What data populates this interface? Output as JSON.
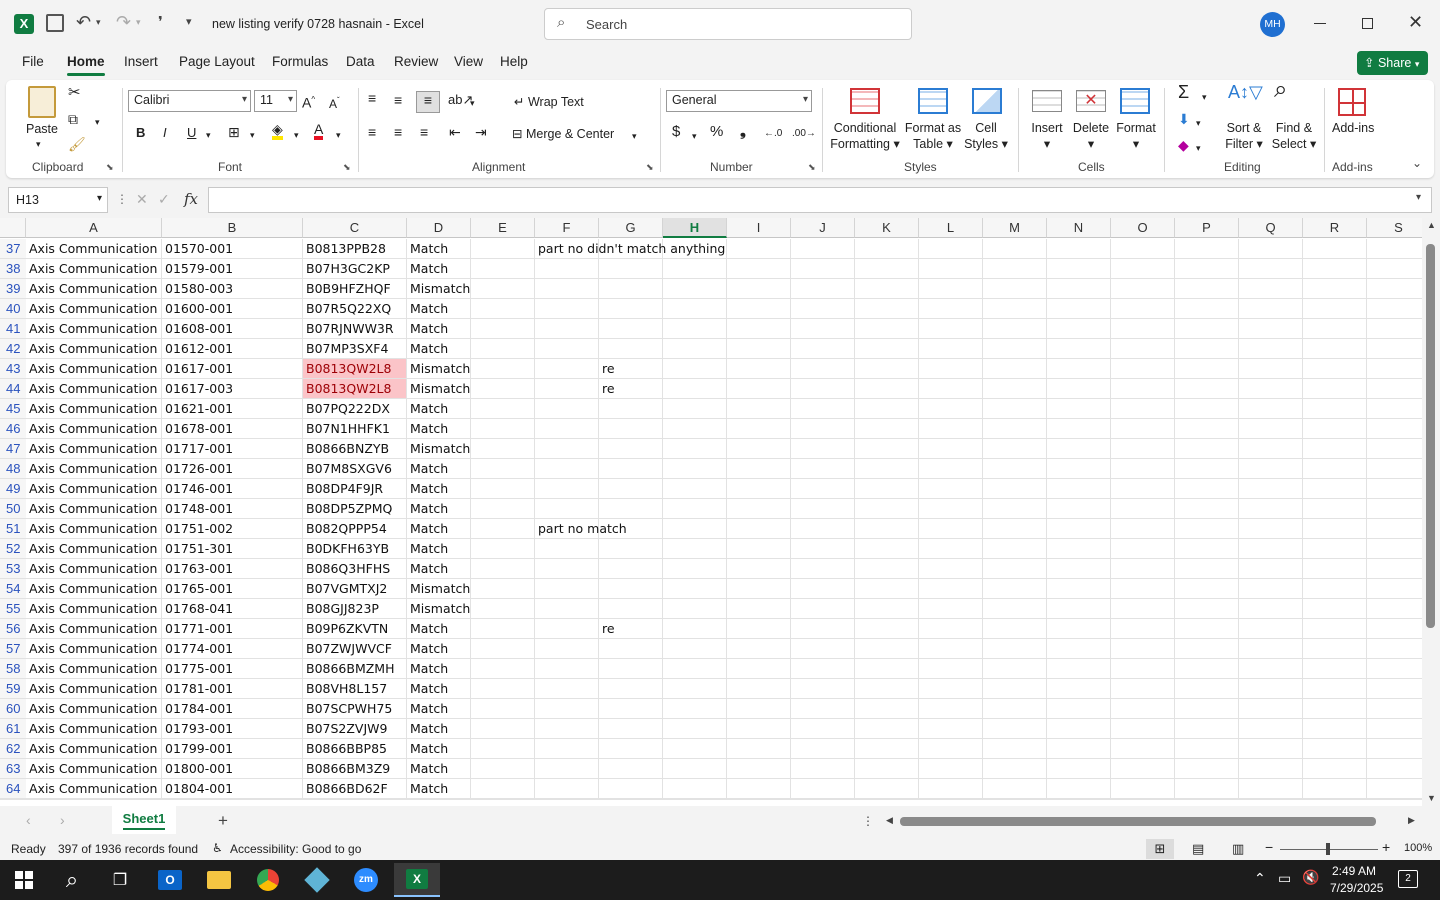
{
  "window": {
    "title": "new listing verify 0728 hasnain  -  Excel",
    "search_placeholder": "Search",
    "user_initials": "MH"
  },
  "menu_tabs": [
    "File",
    "Home",
    "Insert",
    "Page Layout",
    "Formulas",
    "Data",
    "Review",
    "View",
    "Help"
  ],
  "share_label": "Share",
  "ribbon": {
    "clipboard": {
      "paste": "Paste",
      "group": "Clipboard"
    },
    "font": {
      "name": "Calibri",
      "size": "11",
      "group": "Font",
      "bold": "B",
      "italic": "I",
      "underline": "U"
    },
    "alignment": {
      "wrap": "Wrap Text",
      "merge": "Merge & Center",
      "group": "Alignment"
    },
    "number": {
      "format": "General",
      "group": "Number"
    },
    "styles": {
      "cond1": "Conditional",
      "cond2": "Formatting",
      "fmt1": "Format as",
      "fmt2": "Table",
      "cell1": "Cell",
      "cell2": "Styles",
      "group": "Styles"
    },
    "cells": {
      "insert": "Insert",
      "delete": "Delete",
      "format": "Format",
      "group": "Cells"
    },
    "editing": {
      "sort1": "Sort &",
      "sort2": "Filter",
      "find1": "Find &",
      "find2": "Select",
      "group": "Editing"
    },
    "addins": {
      "label": "Add-ins",
      "group": "Add-ins"
    }
  },
  "formula_bar": {
    "name_box": "H13",
    "fx": "fx",
    "content": ""
  },
  "columns": [
    "A",
    "B",
    "C",
    "D",
    "E",
    "F",
    "G",
    "H",
    "I",
    "J",
    "K",
    "L",
    "M",
    "N",
    "O",
    "P",
    "Q",
    "R",
    "S"
  ],
  "selected_column": "H",
  "rows": [
    {
      "n": "37",
      "a": "Axis Communication",
      "b": "01570-001",
      "c": "B0813PPB28",
      "d": "Match",
      "f": "part no didn't match anything",
      "g": ""
    },
    {
      "n": "38",
      "a": "Axis Communication",
      "b": "01579-001",
      "c": "B07H3GC2KP",
      "d": "Match",
      "f": "",
      "g": ""
    },
    {
      "n": "39",
      "a": "Axis Communication",
      "b": "01580-003",
      "c": "B0B9HFZHQF",
      "d": "Mismatch",
      "f": "",
      "g": ""
    },
    {
      "n": "40",
      "a": "Axis Communication",
      "b": "01600-001",
      "c": "B07R5Q22XQ",
      "d": "Match",
      "f": "",
      "g": ""
    },
    {
      "n": "41",
      "a": "Axis Communication",
      "b": "01608-001",
      "c": "B07RJNWW3R",
      "d": "Match",
      "f": "",
      "g": ""
    },
    {
      "n": "42",
      "a": "Axis Communication",
      "b": "01612-001",
      "c": "B07MP3SXF4",
      "d": "Match",
      "f": "",
      "g": ""
    },
    {
      "n": "43",
      "a": "Axis Communication",
      "b": "01617-001",
      "c": "B0813QW2L8",
      "d": "Mismatch",
      "f": "",
      "g": "re",
      "hl": true
    },
    {
      "n": "44",
      "a": "Axis Communication",
      "b": "01617-003",
      "c": "B0813QW2L8",
      "d": "Mismatch",
      "f": "",
      "g": "re",
      "hl": true
    },
    {
      "n": "45",
      "a": "Axis Communication",
      "b": "01621-001",
      "c": "B07PQ222DX",
      "d": "Match",
      "f": "",
      "g": ""
    },
    {
      "n": "46",
      "a": "Axis Communication",
      "b": "01678-001",
      "c": "B07N1HHFK1",
      "d": "Match",
      "f": "",
      "g": ""
    },
    {
      "n": "47",
      "a": "Axis Communication",
      "b": "01717-001",
      "c": "B0866BNZYB",
      "d": "Mismatch",
      "f": "",
      "g": ""
    },
    {
      "n": "48",
      "a": "Axis Communication",
      "b": "01726-001",
      "c": "B07M8SXGV6",
      "d": "Match",
      "f": "",
      "g": ""
    },
    {
      "n": "49",
      "a": "Axis Communication",
      "b": "01746-001",
      "c": "B08DP4F9JR",
      "d": "Match",
      "f": "",
      "g": ""
    },
    {
      "n": "50",
      "a": "Axis Communication",
      "b": "01748-001",
      "c": "B08DP5ZPMQ",
      "d": "Match",
      "f": "",
      "g": ""
    },
    {
      "n": "51",
      "a": "Axis Communication",
      "b": "01751-002",
      "c": "B082QPPP54",
      "d": "Match",
      "f": "part no match",
      "g": ""
    },
    {
      "n": "52",
      "a": "Axis Communication",
      "b": "01751-301",
      "c": "B0DKFH63YB",
      "d": "Match",
      "f": "",
      "g": ""
    },
    {
      "n": "53",
      "a": "Axis Communication",
      "b": "01763-001",
      "c": "B086Q3HFHS",
      "d": "Match",
      "f": "",
      "g": ""
    },
    {
      "n": "54",
      "a": "Axis Communication",
      "b": "01765-001",
      "c": "B07VGMTXJ2",
      "d": "Mismatch",
      "f": "",
      "g": ""
    },
    {
      "n": "55",
      "a": "Axis Communication",
      "b": "01768-041",
      "c": "B08GJJ823P",
      "d": "Mismatch",
      "f": "",
      "g": ""
    },
    {
      "n": "56",
      "a": "Axis Communication",
      "b": "01771-001",
      "c": "B09P6ZKVTN",
      "d": "Match",
      "f": "",
      "g": "re"
    },
    {
      "n": "57",
      "a": "Axis Communication",
      "b": "01774-001",
      "c": "B07ZWJWVCF",
      "d": "Match",
      "f": "",
      "g": ""
    },
    {
      "n": "58",
      "a": "Axis Communication",
      "b": "01775-001",
      "c": "B0866BMZMH",
      "d": "Match",
      "f": "",
      "g": ""
    },
    {
      "n": "59",
      "a": "Axis Communication",
      "b": "01781-001",
      "c": "B08VH8L157",
      "d": "Match",
      "f": "",
      "g": ""
    },
    {
      "n": "60",
      "a": "Axis Communication",
      "b": "01784-001",
      "c": "B07SCPWH75",
      "d": "Match",
      "f": "",
      "g": ""
    },
    {
      "n": "61",
      "a": "Axis Communication",
      "b": "01793-001",
      "c": "B07S2ZVJW9",
      "d": "Match",
      "f": "",
      "g": ""
    },
    {
      "n": "62",
      "a": "Axis Communication",
      "b": "01799-001",
      "c": "B0866BBP85",
      "d": "Match",
      "f": "",
      "g": ""
    },
    {
      "n": "63",
      "a": "Axis Communication",
      "b": "01800-001",
      "c": "B0866BM3Z9",
      "d": "Match",
      "f": "",
      "g": ""
    },
    {
      "n": "64",
      "a": "Axis Communication",
      "b": "01804-001",
      "c": "B0866BD62F",
      "d": "Match",
      "f": "",
      "g": ""
    }
  ],
  "sheet_tab": "Sheet1",
  "status": {
    "ready": "Ready",
    "records": "397 of 1936 records found",
    "accessibility": "Accessibility: Good to go",
    "zoom": "100%"
  },
  "taskbar": {
    "time": "2:49 AM",
    "date": "7/29/2025",
    "notif_count": "2"
  },
  "colors": {
    "excel_green": "#107c41",
    "highlight_fill": "#fbc4c8",
    "highlight_text": "#9c0006",
    "avatar": "#1f6fd1"
  }
}
